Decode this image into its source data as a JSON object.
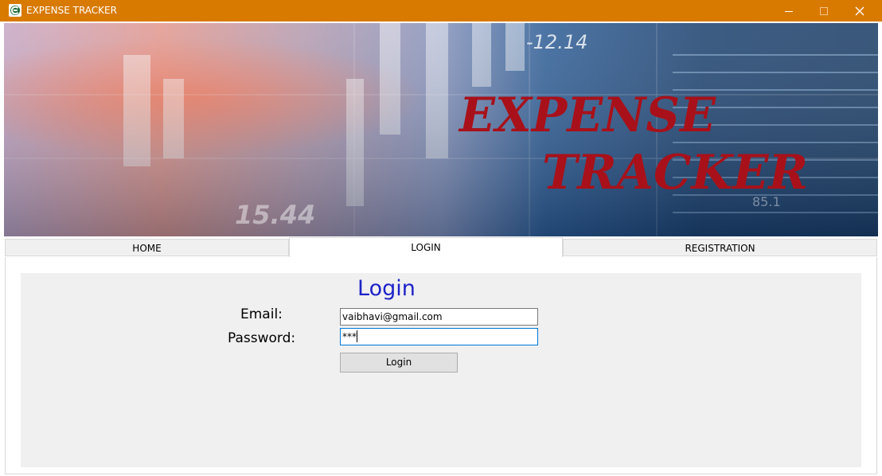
{
  "window": {
    "title": "EXPENSE TRACKER",
    "titlebar_color": "#d87a00",
    "icons": [
      "app-icon",
      "minimize-icon",
      "maximize-icon",
      "close-icon"
    ]
  },
  "banner": {
    "title_line1": "EXPENSE",
    "title_line2": "TRACKER",
    "ticker_top": "-12.14",
    "ticker_bottom": "15.44",
    "ticker_right": "85.1",
    "title_color": "#a8111a"
  },
  "tabs": [
    {
      "label": "HOME",
      "selected": false
    },
    {
      "label": "LOGIN",
      "selected": true
    },
    {
      "label": "REGISTRATION",
      "selected": false
    }
  ],
  "login": {
    "heading": "Login",
    "heading_color": "#1e23c8",
    "email_label": "Email:",
    "email_value": "vaibhavi@gmail.com",
    "password_label": "Password:",
    "password_value": "***",
    "button_label": "Login"
  }
}
